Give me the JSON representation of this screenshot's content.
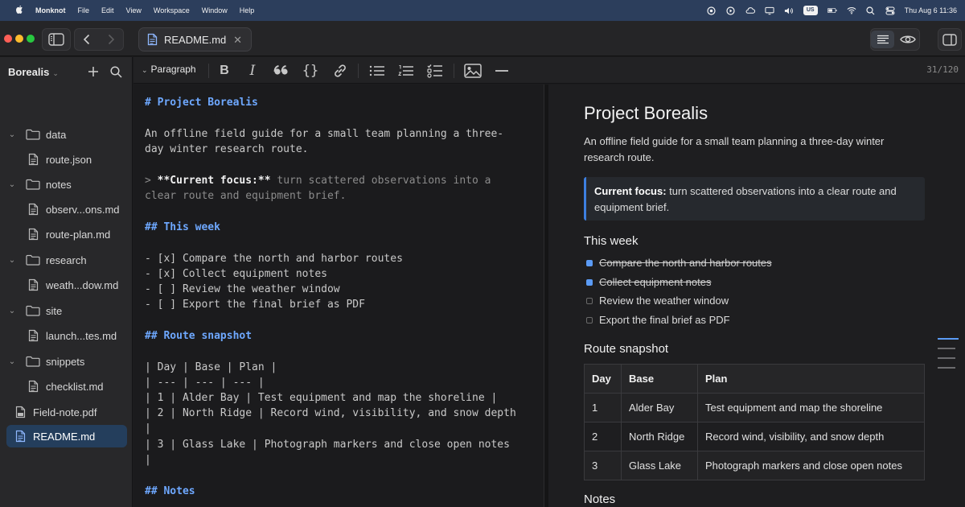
{
  "menubar": {
    "app_name": "Monknot",
    "menus": [
      "File",
      "Edit",
      "View",
      "Workspace",
      "Window",
      "Help"
    ],
    "input_source": "US",
    "clock": "Thu Aug 6  11:36"
  },
  "titlebar": {
    "tab_label": "README.md",
    "colors": {
      "close": "#ff5f57",
      "minimize": "#febc2e",
      "zoom": "#28c840"
    }
  },
  "sidebar": {
    "workspace": "Borealis",
    "items": [
      {
        "label": "data",
        "type": "folder"
      },
      {
        "label": "route.json",
        "type": "file"
      },
      {
        "label": "notes",
        "type": "folder"
      },
      {
        "label": "observ...ons.md",
        "type": "file"
      },
      {
        "label": "route-plan.md",
        "type": "file"
      },
      {
        "label": "research",
        "type": "folder"
      },
      {
        "label": "weath...dow.md",
        "type": "file"
      },
      {
        "label": "site",
        "type": "folder"
      },
      {
        "label": "launch...tes.md",
        "type": "file"
      },
      {
        "label": "snippets",
        "type": "folder"
      },
      {
        "label": "checklist.md",
        "type": "file"
      },
      {
        "label": "Field-note.pdf",
        "type": "pdf"
      },
      {
        "label": "README.md",
        "type": "file",
        "selected": true
      }
    ]
  },
  "toolbar": {
    "block_style": "Paragraph",
    "word_count": "31/120"
  },
  "editor": {
    "h1": "# Project Borealis",
    "intro_1": "An offline field guide for a small team planning a three-",
    "intro_2": "day winter research route.",
    "quote_marker": "> ",
    "quote_bold": "**Current focus:**",
    "quote_rest_1": " turn scattered observations into a",
    "quote_rest_2": "clear route and equipment brief.",
    "h2_week": "## This week",
    "tasks": [
      "- [x] Compare the north and harbor routes",
      "- [x] Collect equipment notes",
      "- [ ] Review the weather window",
      "- [ ] Export the final brief as PDF"
    ],
    "h2_route": "## Route snapshot",
    "table_lines": [
      "| Day | Base | Plan |",
      "| --- | --- | --- |",
      "| 1 | Alder Bay | Test equipment and map the shoreline |",
      "| 2 | North Ridge | Record wind, visibility, and snow depth",
      "|",
      "| 3 | Glass Lake | Photograph markers and close open notes",
      "|"
    ],
    "h2_notes": "## Notes"
  },
  "preview": {
    "title": "Project Borealis",
    "intro": "An offline field guide for a small team planning a three-day winter research route.",
    "quote_bold": "Current focus:",
    "quote_rest": " turn scattered observations into a clear route and equipment brief.",
    "h2_week": "This week",
    "tasks": [
      {
        "text": "Compare the north and harbor routes",
        "done": true
      },
      {
        "text": "Collect equipment notes",
        "done": true
      },
      {
        "text": "Review the weather window",
        "done": false
      },
      {
        "text": "Export the final brief as PDF",
        "done": false
      }
    ],
    "h2_route": "Route snapshot",
    "table": {
      "headers": [
        "Day",
        "Base",
        "Plan"
      ],
      "rows": [
        [
          "1",
          "Alder Bay",
          "Test equipment and map the shoreline"
        ],
        [
          "2",
          "North Ridge",
          "Record wind, visibility, and snow depth"
        ],
        [
          "3",
          "Glass Lake",
          "Photograph markers and close open notes"
        ]
      ]
    },
    "h2_notes": "Notes"
  }
}
